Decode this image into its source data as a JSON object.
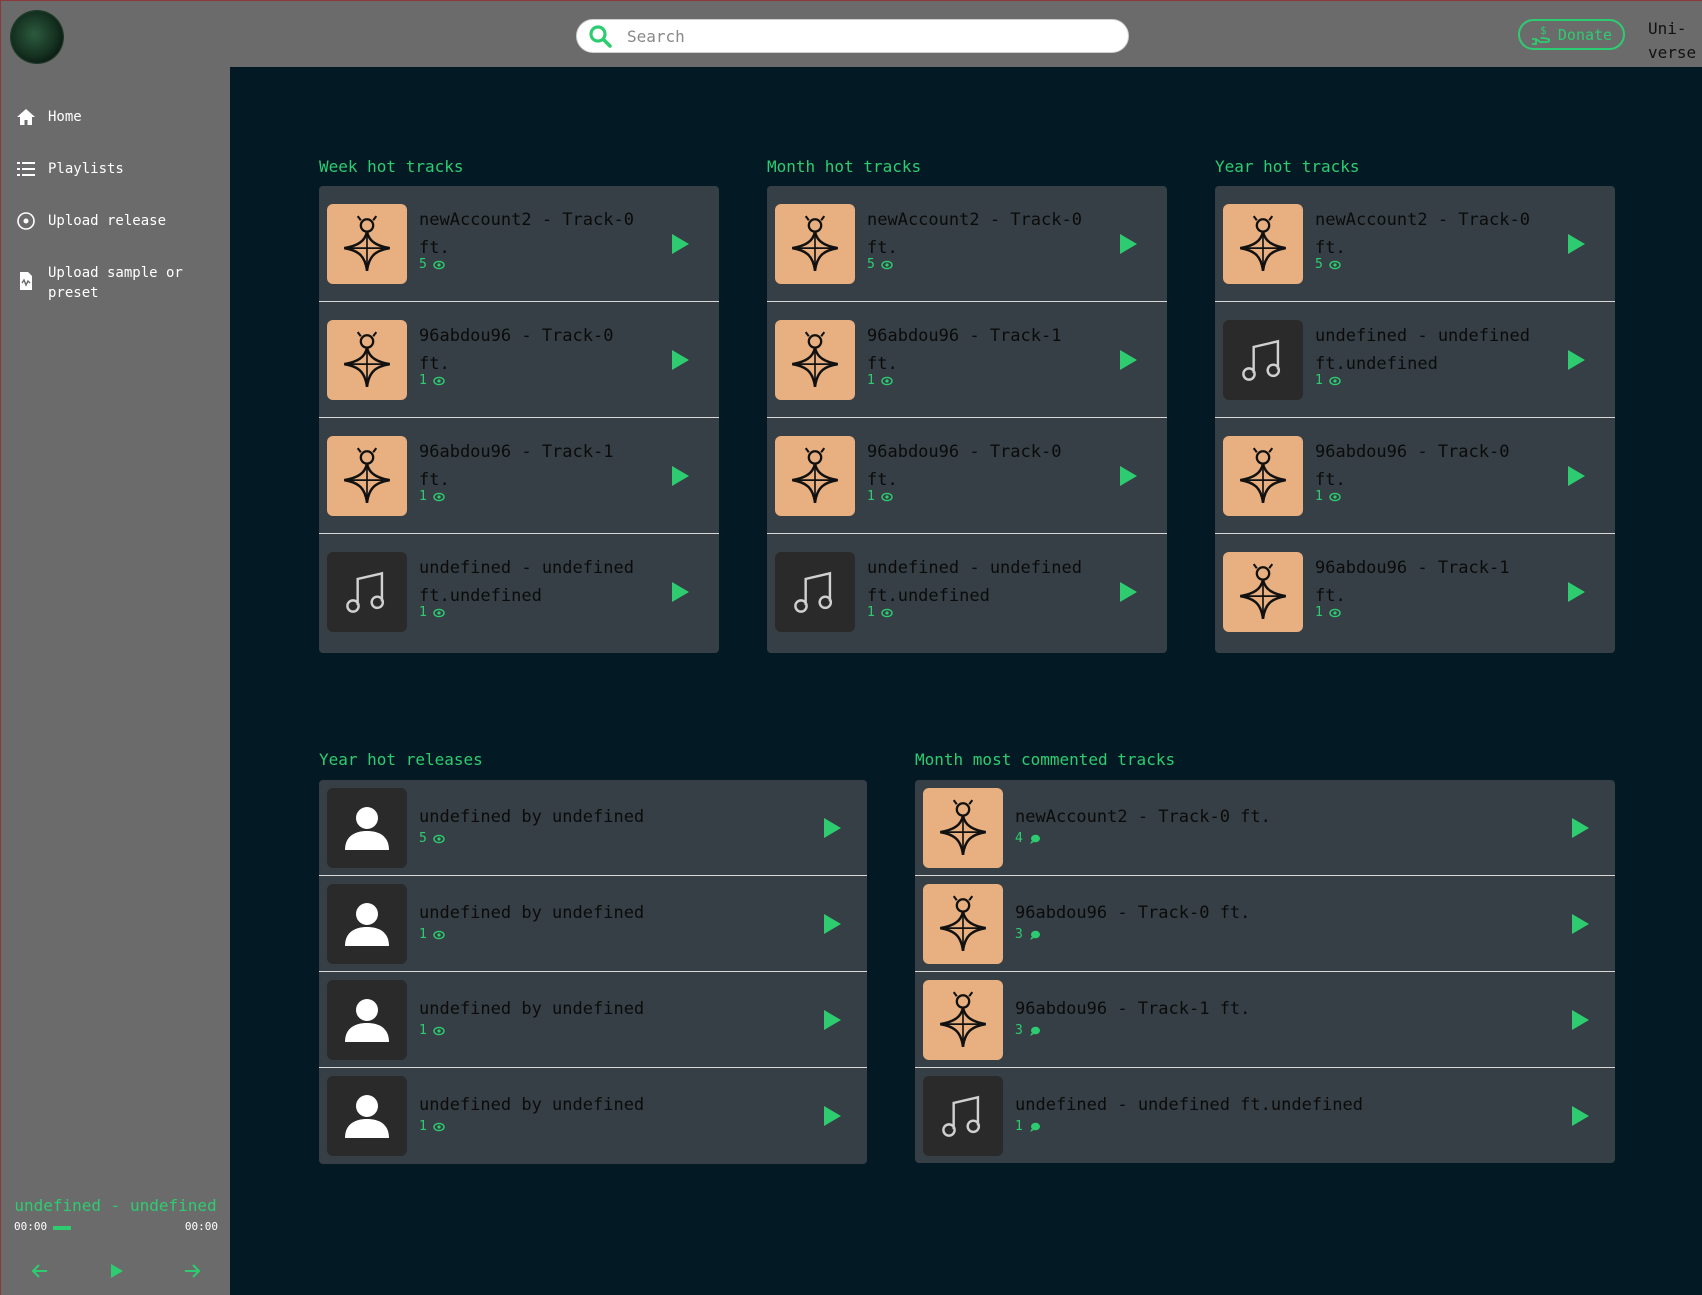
{
  "header": {
    "search_placeholder": "Search",
    "donate_label": "Donate",
    "user_name": "Uni-\nverse"
  },
  "sidebar": {
    "items": [
      {
        "label": "Home",
        "icon": "home-icon"
      },
      {
        "label": "Playlists",
        "icon": "list-icon"
      },
      {
        "label": "Upload release",
        "icon": "disc-icon"
      },
      {
        "label": "Upload sample or preset",
        "icon": "file-audio-icon"
      }
    ]
  },
  "player": {
    "title": "undefined - undefined",
    "current_time": "00:00",
    "duration": "00:00"
  },
  "sections": {
    "week": {
      "title": "Week hot tracks",
      "rows": [
        {
          "title": "newAccount2 - Track-0\nft.",
          "count": "5",
          "thumb": "art"
        },
        {
          "title": "96abdou96 - Track-0\nft.",
          "count": "1",
          "thumb": "art"
        },
        {
          "title": "96abdou96 - Track-1\nft.",
          "count": "1",
          "thumb": "art"
        },
        {
          "title": "undefined - undefined\nft.undefined",
          "count": "1",
          "thumb": "note"
        }
      ]
    },
    "month": {
      "title": "Month hot tracks",
      "rows": [
        {
          "title": "newAccount2 - Track-0\nft.",
          "count": "5",
          "thumb": "art"
        },
        {
          "title": "96abdou96 - Track-1\nft.",
          "count": "1",
          "thumb": "art"
        },
        {
          "title": "96abdou96 - Track-0\nft.",
          "count": "1",
          "thumb": "art"
        },
        {
          "title": "undefined - undefined\nft.undefined",
          "count": "1",
          "thumb": "note"
        }
      ]
    },
    "year": {
      "title": "Year hot tracks",
      "rows": [
        {
          "title": "newAccount2 - Track-0\nft.",
          "count": "5",
          "thumb": "art"
        },
        {
          "title": "undefined - undefined\nft.undefined",
          "count": "1",
          "thumb": "note"
        },
        {
          "title": "96abdou96 - Track-0\nft.",
          "count": "1",
          "thumb": "art"
        },
        {
          "title": "96abdou96 - Track-1\nft.",
          "count": "1",
          "thumb": "art"
        }
      ]
    },
    "releases": {
      "title": "Year hot releases",
      "rows": [
        {
          "title": "undefined by undefined",
          "count": "5",
          "thumb": "user"
        },
        {
          "title": "undefined by undefined",
          "count": "1",
          "thumb": "user"
        },
        {
          "title": "undefined by undefined",
          "count": "1",
          "thumb": "user"
        },
        {
          "title": "undefined by undefined",
          "count": "1",
          "thumb": "user"
        }
      ]
    },
    "commented": {
      "title": "Month most commented tracks",
      "rows": [
        {
          "title": "newAccount2 - Track-0 ft.",
          "count": "4",
          "thumb": "art"
        },
        {
          "title": "96abdou96 - Track-0 ft.",
          "count": "3",
          "thumb": "art"
        },
        {
          "title": "96abdou96 - Track-1 ft.",
          "count": "3",
          "thumb": "art"
        },
        {
          "title": "undefined - undefined ft.undefined",
          "count": "1",
          "thumb": "note"
        }
      ]
    }
  },
  "colors": {
    "accent": "#2ecc71",
    "main_bg": "#031a24",
    "card_bg": "#353f45",
    "sidebar_bg": "#6b6b6b",
    "art_bg": "#e8b080"
  }
}
